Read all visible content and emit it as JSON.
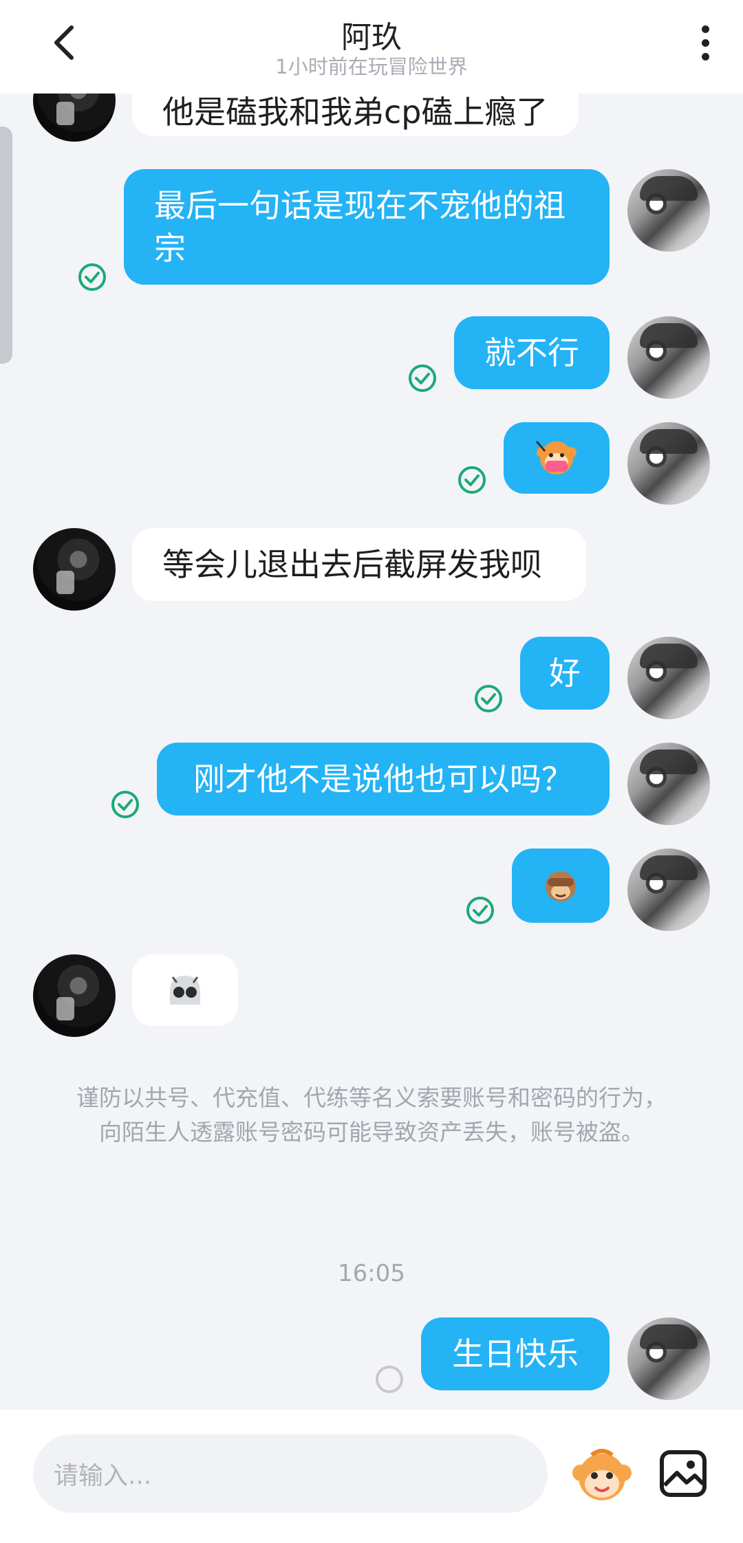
{
  "header": {
    "title": "阿玖",
    "subtitle": "1小时前在玩冒险世界"
  },
  "messages": [
    {
      "from": "peer",
      "text": "他是磕我和我弟cp磕上瘾了"
    },
    {
      "from": "self",
      "text": "最后一句话是现在不宠他的祖宗",
      "status": "read"
    },
    {
      "from": "self",
      "text": "就不行",
      "status": "read"
    },
    {
      "from": "self",
      "sticker": "monkey-mask-emoji",
      "status": "read"
    },
    {
      "from": "peer",
      "text": "等会儿退出去后截屏发我呗"
    },
    {
      "from": "self",
      "text": "好",
      "status": "read"
    },
    {
      "from": "self",
      "text": "刚才他不是说他也可以吗？",
      "status": "read"
    },
    {
      "from": "self",
      "sticker": "see-no-evil-monkey-emoji",
      "status": "read"
    },
    {
      "from": "peer",
      "sticker": "cute-ghost-emoji"
    },
    {
      "from": "self",
      "text": "生日快乐",
      "status": "sending"
    }
  ],
  "notice": "谨防以共号、代充值、代练等名义索要账号和密码的行为，向陌生人透露账号密码可能导致资产丢失，账号被盗。",
  "timestamp": "16:05",
  "composer": {
    "placeholder": "请输入..."
  },
  "colors": {
    "self_bubble": "#24b3f5",
    "peer_bubble": "#ffffff",
    "read_tick": "#1aaa75",
    "background": "#f2f4f8"
  }
}
